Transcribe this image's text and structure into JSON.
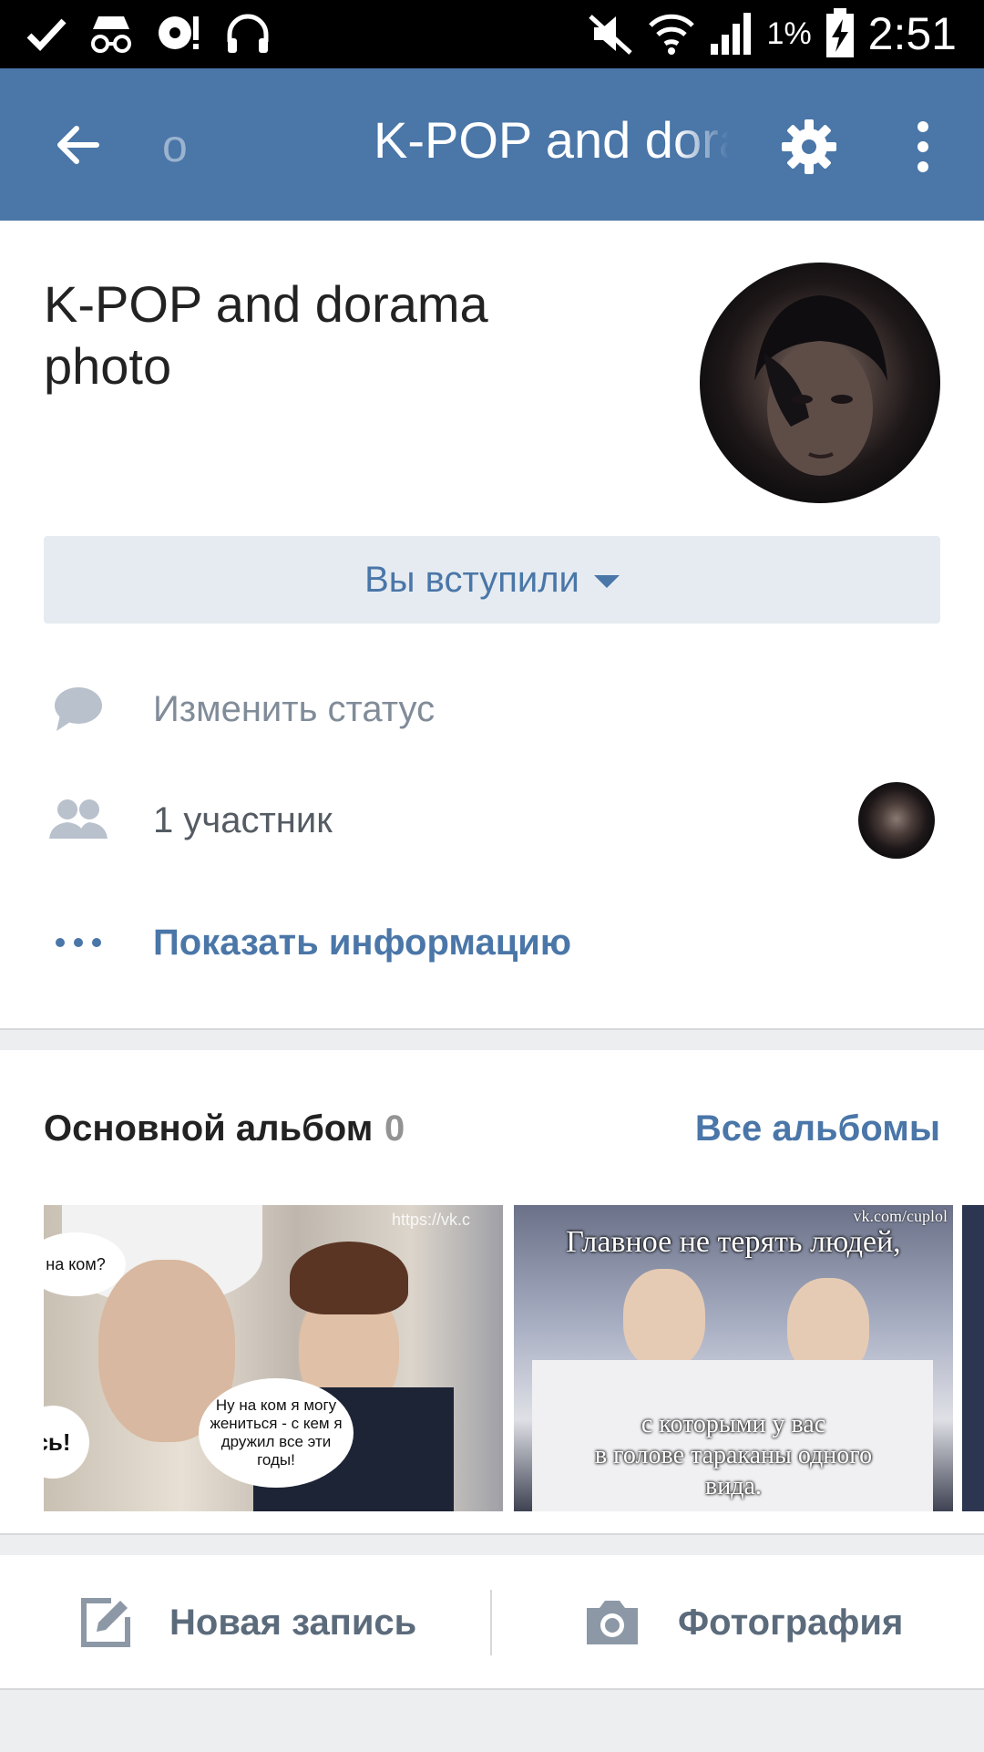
{
  "status_bar": {
    "battery_percent": "1%",
    "time": "2:51"
  },
  "toolbar": {
    "ghost_text": "o",
    "title": "K-POP and dorama photo"
  },
  "group": {
    "name": "K-POP and dorama photo",
    "join_label": "Вы вступили",
    "change_status": "Изменить статус",
    "members": "1 участник",
    "show_info": "Показать информацию"
  },
  "album": {
    "title": "Основной альбом",
    "count": "0",
    "all_albums": "Все альбомы",
    "photo1": {
      "url": "https://vk.c",
      "bubble_top": "на ком?",
      "bubble_main": "Ну на ком я могу жениться - с кем я дружил все эти годы!",
      "bubble_left": "сь!"
    },
    "photo2": {
      "url": "vk.com/cuplol",
      "caption_top": "Главное не терять людей,",
      "caption_bottom": "с которыми у вас\nв голове тараканы одного\nвида."
    }
  },
  "actions": {
    "new_post": "Новая запись",
    "photo": "Фотография"
  },
  "colors": {
    "brand": "#4a76a8",
    "bg_separator": "#edeef0"
  }
}
